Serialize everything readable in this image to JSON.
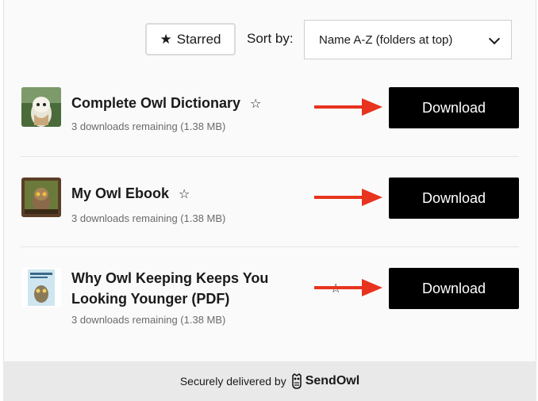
{
  "toolbar": {
    "starred_label": "Starred",
    "sort_label": "Sort by:",
    "sort_selected": "Name A-Z (folders at top)"
  },
  "products": [
    {
      "title": "Complete Owl Dictionary",
      "meta": "3 downloads remaining  (1.38 MB)",
      "button": "Download"
    },
    {
      "title": "My Owl Ebook",
      "meta": "3 downloads remaining  (1.38 MB)",
      "button": "Download"
    },
    {
      "title_line1": "Why Owl Keeping Keeps You",
      "title_line2": "Looking Younger (PDF)",
      "meta": "3 downloads remaining  (1.38 MB)",
      "button": "Download"
    }
  ],
  "footer": {
    "text": "Securely delivered by",
    "brand": "SendOwl"
  },
  "colors": {
    "button_bg": "#000000",
    "arrow": "#e8331e",
    "footer_bg": "#e9e9e9"
  }
}
